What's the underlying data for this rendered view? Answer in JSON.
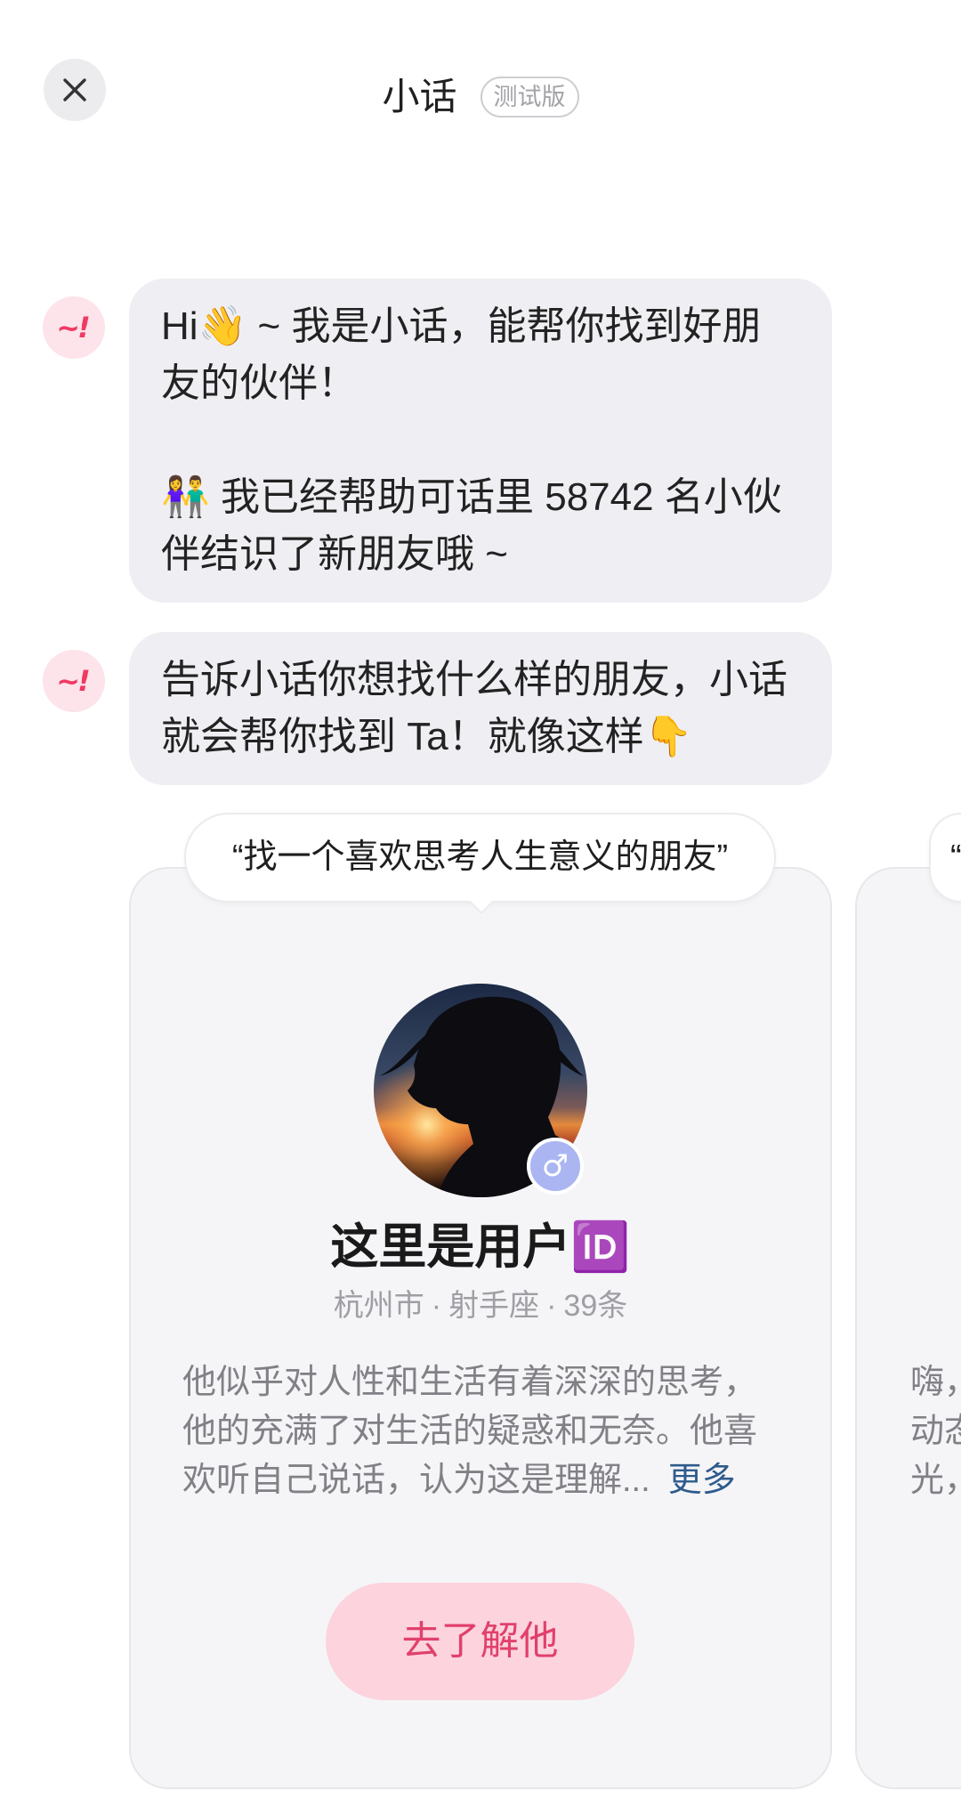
{
  "header": {
    "title": "小话",
    "badge": "测试版",
    "close_icon": "close-icon"
  },
  "bot": {
    "logo_text": "~!",
    "logo_color": "#ef3a63",
    "logo_bg": "#fde3ea"
  },
  "messages": [
    {
      "paragraphs": [
        [
          "Hi👋 ~ 我是小话，能帮你找到好朋",
          "友的伙伴！"
        ],
        [
          "👫 我已经帮助可话里 58742 名小伙",
          "伴结识了新朋友哦 ~"
        ]
      ]
    },
    {
      "paragraphs": [
        [
          "告诉小话你想找什么样的朋友，小话",
          "就会帮你找到 Ta！就像这样👇"
        ]
      ]
    }
  ],
  "cards": [
    {
      "query": "“找一个喜欢思考人生意义的朋友”",
      "gender_icon": "male-icon",
      "gender_symbol": "♂",
      "name": "这里是用户🆔",
      "meta": {
        "city": "杭州市",
        "zodiac": "射手座",
        "posts": "39条",
        "separator": "·"
      },
      "description_lines": [
        "他似乎对人性和生活有着深深的思考，",
        "他的充满了对生活的疑惑和无奈。他喜",
        "欢听自己说话，认为这是理解..."
      ],
      "more_label": "更多",
      "action_label": "去了解他"
    },
    {
      "query": "“",
      "description_lines": [
        "嗨，",
        "动态",
        "光，"
      ]
    }
  ],
  "colors": {
    "bubble_bg": "#efeff3",
    "card_bg": "#f5f5f7",
    "button_bg": "#fdd3dd",
    "button_text": "#e0416c",
    "link": "#2f5b8d",
    "gender_badge": "#aab5f2"
  }
}
